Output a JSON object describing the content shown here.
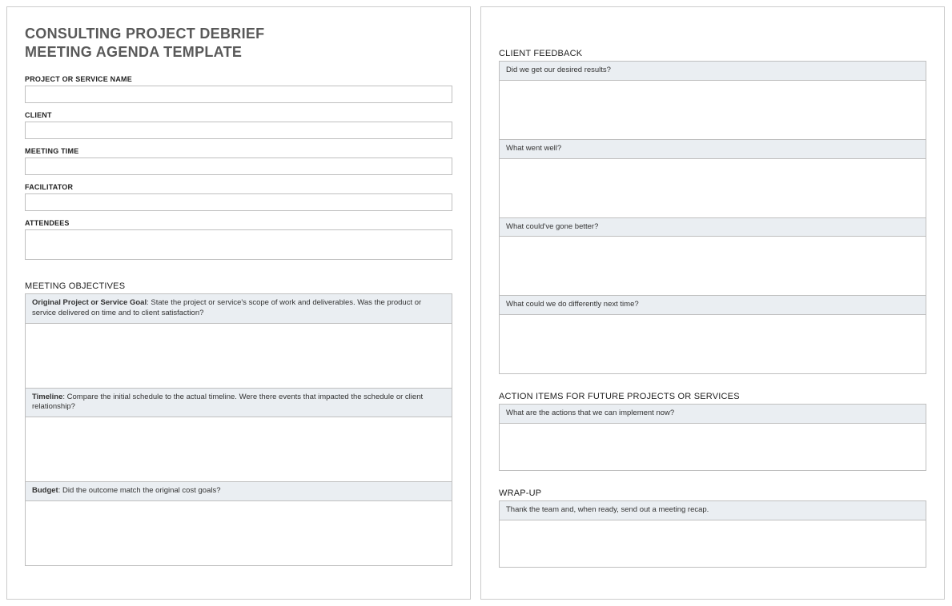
{
  "title_line1": "CONSULTING PROJECT DEBRIEF",
  "title_line2": "MEETING AGENDA TEMPLATE",
  "fields": {
    "project": "PROJECT OR SERVICE NAME",
    "client": "CLIENT",
    "meeting_time": "MEETING TIME",
    "facilitator": "FACILITATOR",
    "attendees": "ATTENDEES"
  },
  "objectives": {
    "header": "MEETING OBJECTIVES",
    "goal_b": "Original Project or Service Goal",
    "goal_t": ": State the project or service's scope of work and deliverables. Was the product or service delivered on time and to client satisfaction?",
    "timeline_b": "Timeline",
    "timeline_t": ": Compare the initial schedule to the actual timeline. Were there events that impacted the schedule or client relationship?",
    "budget_b": "Budget",
    "budget_t": ": Did the outcome match the original cost goals?"
  },
  "feedback": {
    "header": "CLIENT FEEDBACK",
    "q1": "Did we get our desired results?",
    "q2": "What went well?",
    "q3": "What could've gone better?",
    "q4": "What could we do differently next time?"
  },
  "actions": {
    "header": "ACTION ITEMS FOR FUTURE PROJECTS OR SERVICES",
    "q": "What are the actions that we can implement now?"
  },
  "wrapup": {
    "header": "WRAP-UP",
    "q": "Thank the team and, when ready, send out a meeting recap."
  }
}
